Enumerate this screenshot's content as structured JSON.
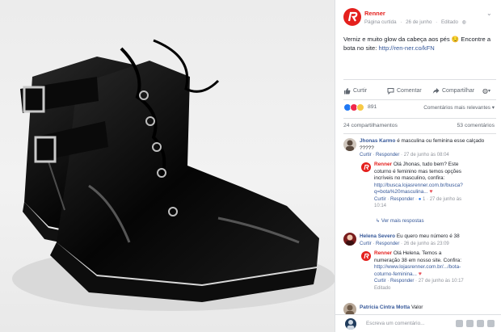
{
  "colors": {
    "brand_red": "#e4201d",
    "link_blue": "#365899",
    "muted": "#90949c",
    "like_blue": "#2078f4",
    "love_red": "#f0284a",
    "wow_yellow": "#f7c946"
  },
  "post": {
    "page_name": "Renner",
    "page_type": "Página curtida",
    "date": "26 de junho",
    "edited": "Editado",
    "text": "Verniz e muito glow da cabeça aos pés 😏 Encontre a bota no site:",
    "link": "http://ren-ner.co/kFN"
  },
  "actions": {
    "like": "Curtir",
    "comment": "Comentar",
    "share": "Compartilhar"
  },
  "reactions": {
    "icons": [
      "like-icon",
      "love-icon",
      "wow-icon"
    ],
    "count": "891",
    "sort_label": "Comentários mais relevantes ▾"
  },
  "stats": {
    "shares": "24 compartilhamentos",
    "comments": "53 comentários"
  },
  "comments": [
    {
      "author": "Jhonas Karmo",
      "text": "é masculina ou feminina esse calçado ?????",
      "like": "Curtir",
      "reply": "Responder",
      "time": "27 de junho às 08:04",
      "reply_item": {
        "author": "Renner",
        "text_line1": "Olá Jhonas, tudo bem? Este",
        "text_line2": "coturno é feminino mas temos opções",
        "text_line3": "incríveis no masculino, confira:",
        "link_line1": "http://busca.lojasrenner.com.br/busca?",
        "link_line2": "q=bota%20masculina...",
        "like": "Curtir",
        "reply": "Responder",
        "reactions": "1",
        "time": "27 de junho às",
        "time2": "10:14"
      },
      "more_replies": "Ver mais respostas"
    },
    {
      "author": "Helena Severo",
      "text": "Eu quero meu número é 38",
      "like": "Curtir",
      "reply": "Responder",
      "time": "26 de junho às 23:09",
      "reply_item": {
        "author": "Renner",
        "text_line1": "Olá Helena. Temos a",
        "text_line2": "numeração 38 em nosso site. Confira:",
        "link_line1": "http://www.lojasrenner.com.br/.../bota-",
        "link_line2": "coturno-feminina...",
        "like": "Curtir",
        "reply": "Responder",
        "time": "27 de junho às 10:17",
        "edited": "Editado"
      }
    },
    {
      "author": "Patrícia Cintra Motta",
      "text": "Valor"
    }
  ],
  "compose": {
    "placeholder": "Escreva um comentário..."
  }
}
